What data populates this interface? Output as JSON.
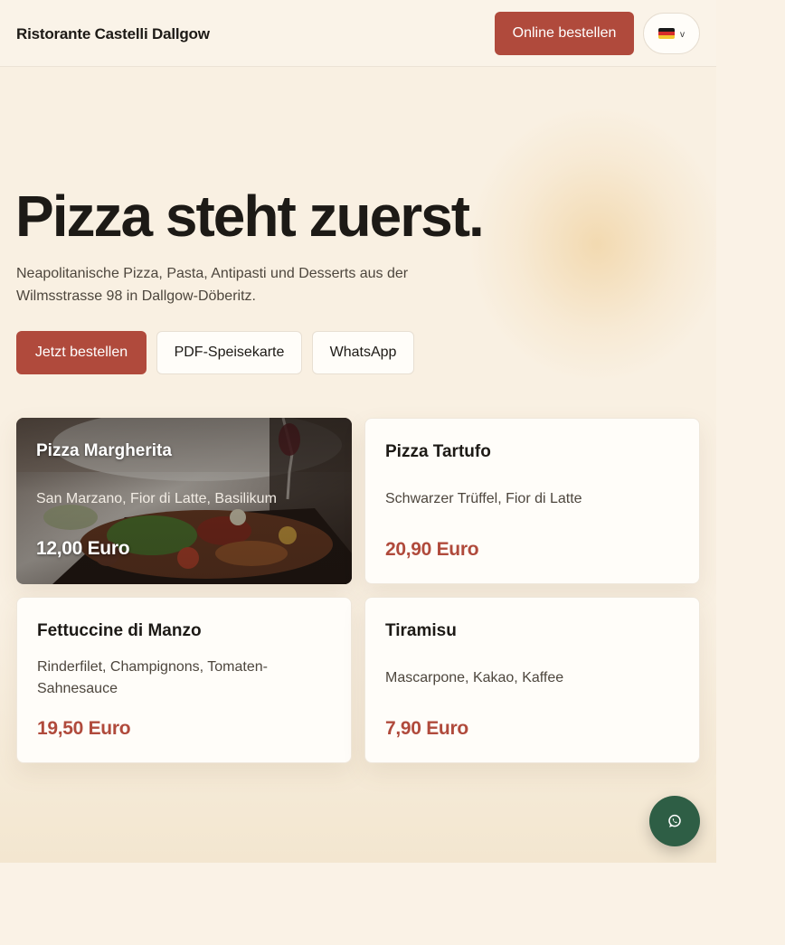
{
  "header": {
    "brand": "Ristorante Castelli Dallgow",
    "order_label": "Online bestellen",
    "language": {
      "icon": "german-flag-icon",
      "chevron": "v"
    }
  },
  "hero": {
    "title": "Pizza steht zuerst.",
    "subtitle": "Neapolitanische Pizza, Pasta, Antipasti und Desserts aus der Wilmsstrasse 98 in Dallgow-Döberitz.",
    "buttons": {
      "primary": "Jetzt bestellen",
      "pdf": "PDF-Speisekarte",
      "whatsapp": "WhatsApp"
    }
  },
  "menu": [
    {
      "name": "Pizza Margherita",
      "description": "San Marzano, Fior di Latte, Basilikum",
      "price": "12,00 Euro",
      "image": "food-photo"
    },
    {
      "name": "Pizza Tartufo",
      "description": "Schwarzer Trüffel, Fior di Latte",
      "price": "20,90 Euro"
    },
    {
      "name": "Fettuccine di Manzo",
      "description": "Rinderfilet, Champignons, Tomaten-Sahnesauce",
      "price": "19,50 Euro"
    },
    {
      "name": "Tiramisu",
      "description": "Mascarpone, Kakao, Kaffee",
      "price": "7,90 Euro"
    }
  ],
  "floating": {
    "icon": "whatsapp-icon"
  },
  "colors": {
    "accent": "#b04a3c",
    "background": "#f9f0e2",
    "whatsapp": "#2e5e45"
  }
}
